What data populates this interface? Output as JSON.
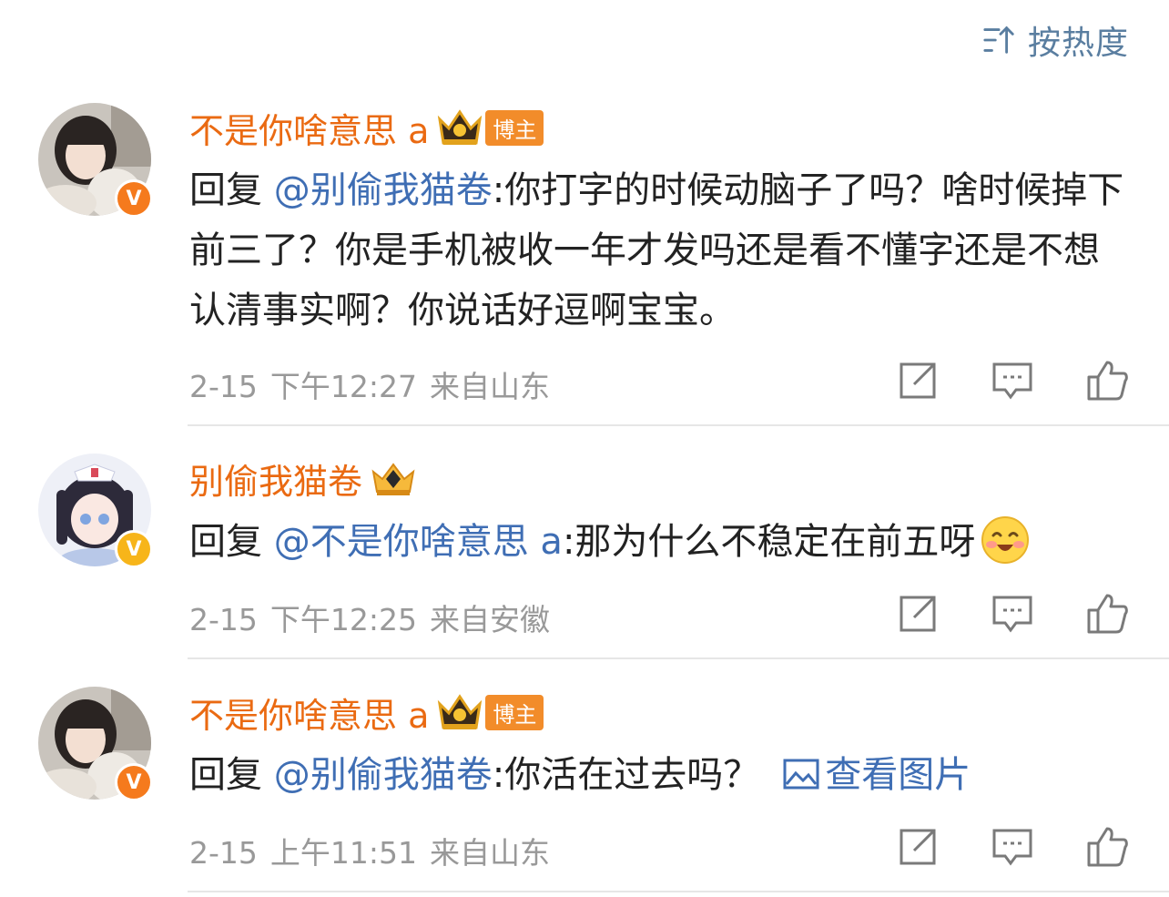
{
  "sort": {
    "label": "按热度",
    "icon": "sort-icon"
  },
  "colors": {
    "username": "#ea6a12",
    "mention": "#3f6eb4",
    "meta": "#999999",
    "role_badge": "#f28c2a"
  },
  "comments": [
    {
      "username": "不是你啥意思 a",
      "role_badge": "博主",
      "verified": "V",
      "reply_prefix": "回复 ",
      "mention": "@别偷我猫卷",
      "text": ":你打字的时候动脑子了吗？啥时候掉下前三了？你是手机被收一年才发吗还是看不懂字还是不想认清事实啊？你说话好逗啊宝宝。",
      "date": "2-15",
      "time": "下午12:27",
      "location": "来自山东"
    },
    {
      "username": "别偷我猫卷",
      "verified": "V",
      "reply_prefix": "回复 ",
      "mention": "@不是你啥意思 a",
      "text": ":那为什么不稳定在前五呀",
      "emoji": "blush-emoji",
      "date": "2-15",
      "time": "下午12:25",
      "location": "来自安徽"
    },
    {
      "username": "不是你啥意思 a",
      "role_badge": "博主",
      "verified": "V",
      "reply_prefix": "回复 ",
      "mention": "@别偷我猫卷",
      "text": ":你活在过去吗？",
      "view_picture": "查看图片",
      "date": "2-15",
      "time": "上午11:51",
      "location": "来自山东"
    }
  ]
}
